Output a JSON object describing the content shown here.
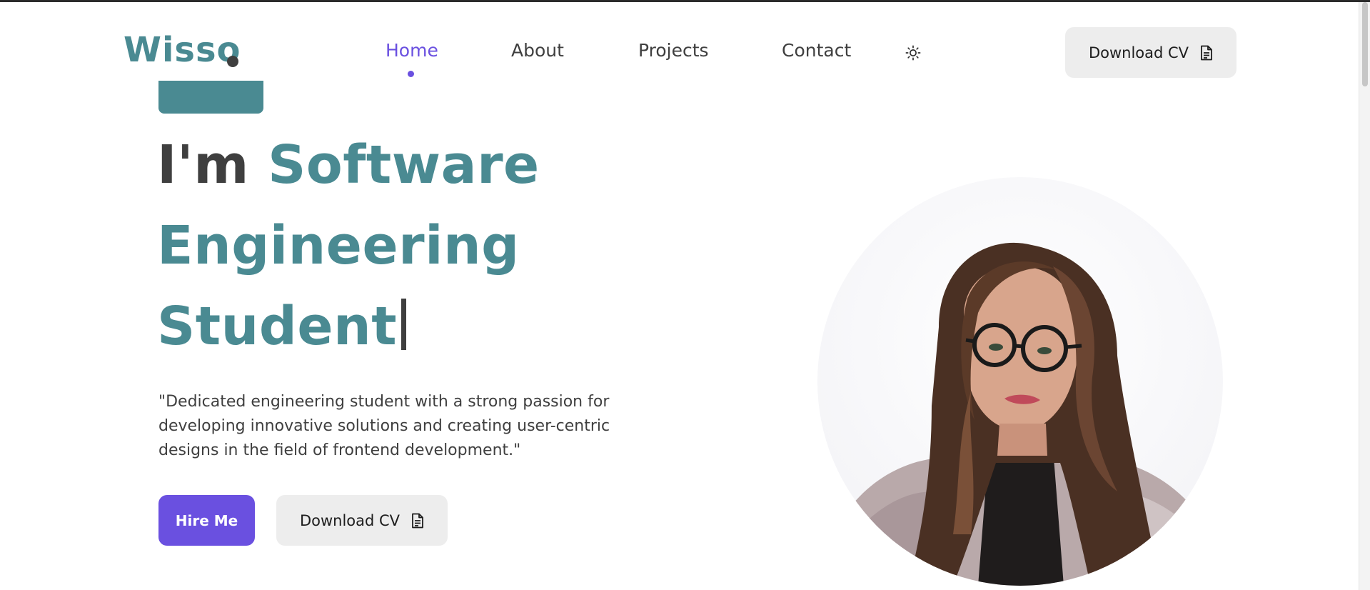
{
  "navbar": {
    "logo_text": "Wisso",
    "links": [
      {
        "label": "Home",
        "active": true
      },
      {
        "label": "About",
        "active": false
      },
      {
        "label": "Projects",
        "active": false
      },
      {
        "label": "Contact",
        "active": false
      }
    ],
    "theme_toggle_icon": "sun-icon",
    "download_cv_label": "Download CV",
    "download_cv_icon": "document-icon"
  },
  "hero": {
    "badge_text": "",
    "headline_prefix": "I'm",
    "headline_role_line1": "Software",
    "headline_role_line2": "Engineering",
    "headline_role_line3": "Student",
    "tagline": "\"Dedicated engineering student with a strong passion for developing innovative solutions and creating user-centric designs in the field of frontend development.\"",
    "hire_button_label": "Hire Me",
    "download_cv_label": "Download CV",
    "download_cv_icon": "document-icon"
  },
  "colors": {
    "accent_teal": "#4a8a92",
    "accent_purple": "#6a50e0",
    "text_dark": "#3f3f3f",
    "button_light": "#ededed"
  }
}
